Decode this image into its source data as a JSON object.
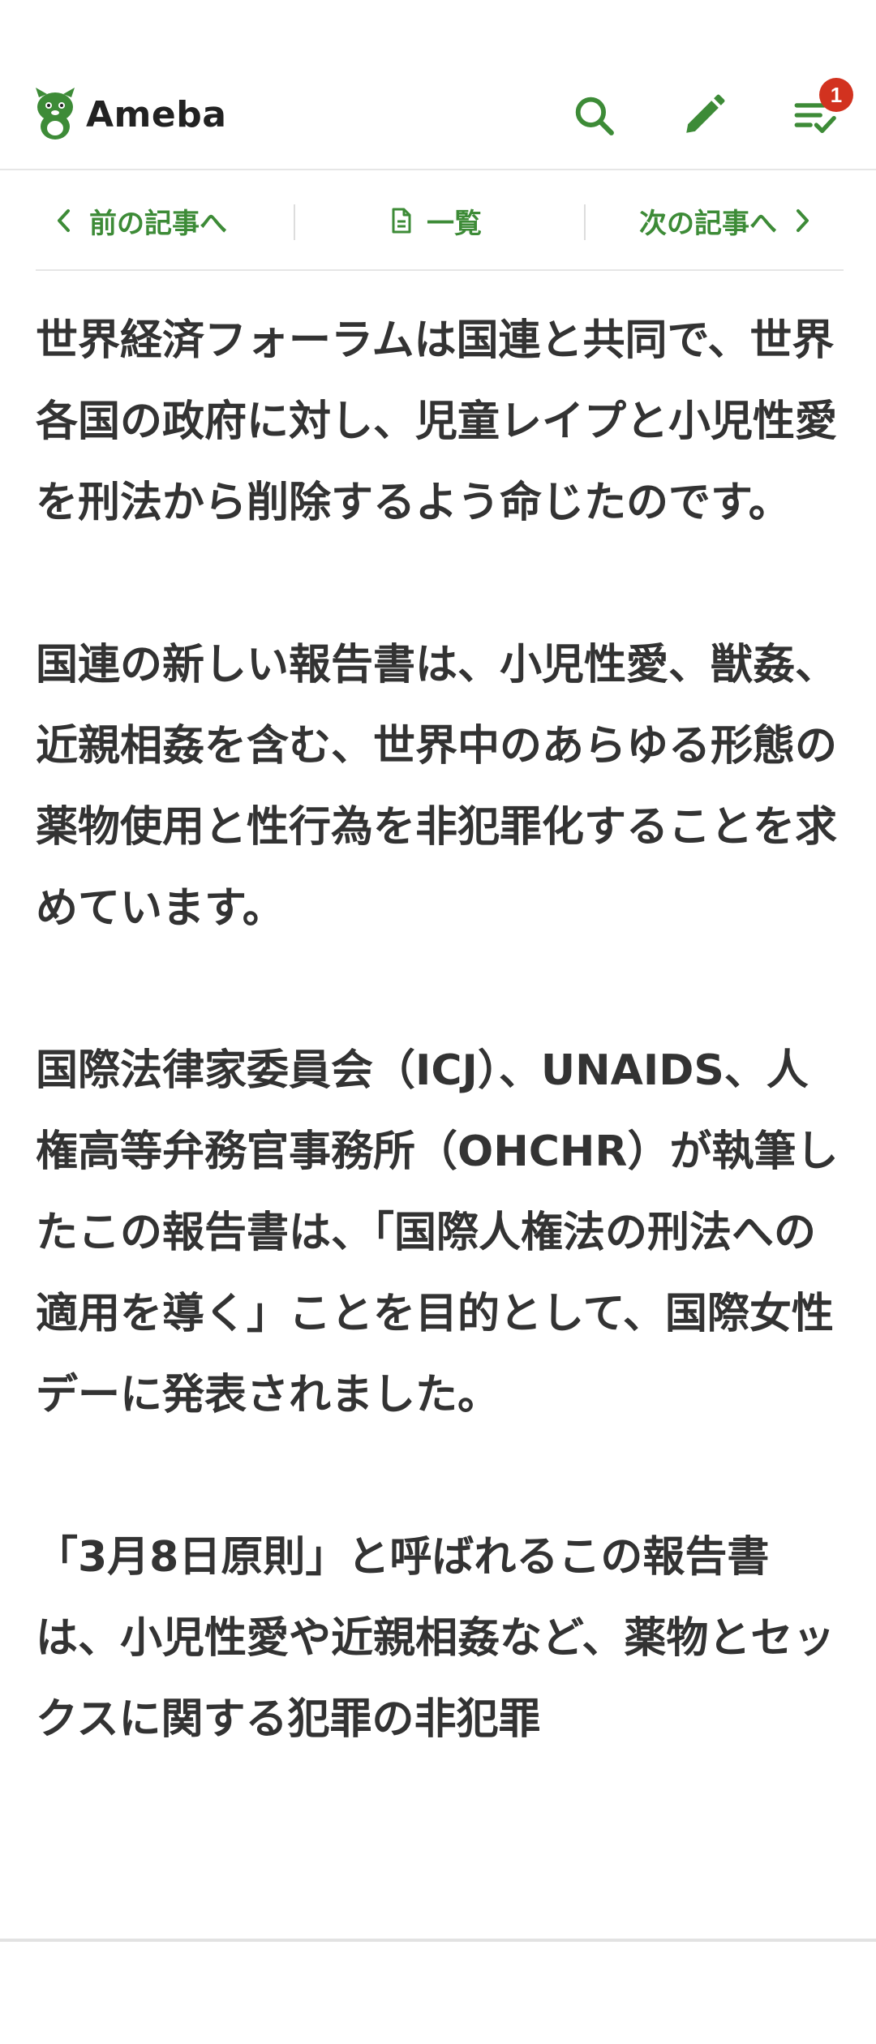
{
  "header": {
    "logo_text": "Ameba",
    "notification_count": "1",
    "icons": [
      "ameba-mascot-icon",
      "search-icon",
      "pencil-icon",
      "reading-list-icon"
    ],
    "brand_color": "#3d8b37",
    "badge_color": "#d2321f"
  },
  "nav": {
    "prev_label": "前の記事へ",
    "list_label": "一覧",
    "next_label": "次の記事へ"
  },
  "article": {
    "paragraphs": [
      "世界経済フォーラムは国連と共同で、世界各国の政府に対し、児童レイプと小児性愛を刑法から削除するよう命じたのです。",
      "国連の新しい報告書は、小児性愛、獣姦、近親相姦を含む、世界中のあらゆる形態の薬物使用と性行為を非犯罪化することを求めています。",
      "国際法律家委員会（ICJ）、UNAIDS、人権高等弁務官事務所（OHCHR）が執筆したこの報告書は、「国際人権法の刑法への適用を導く」ことを目的として、国際女性デーに発表されました。",
      "「3月8日原則」と呼ばれるこの報告書は、小児性愛や近親相姦など、薬物とセックスに関する犯罪の非犯罪"
    ]
  }
}
